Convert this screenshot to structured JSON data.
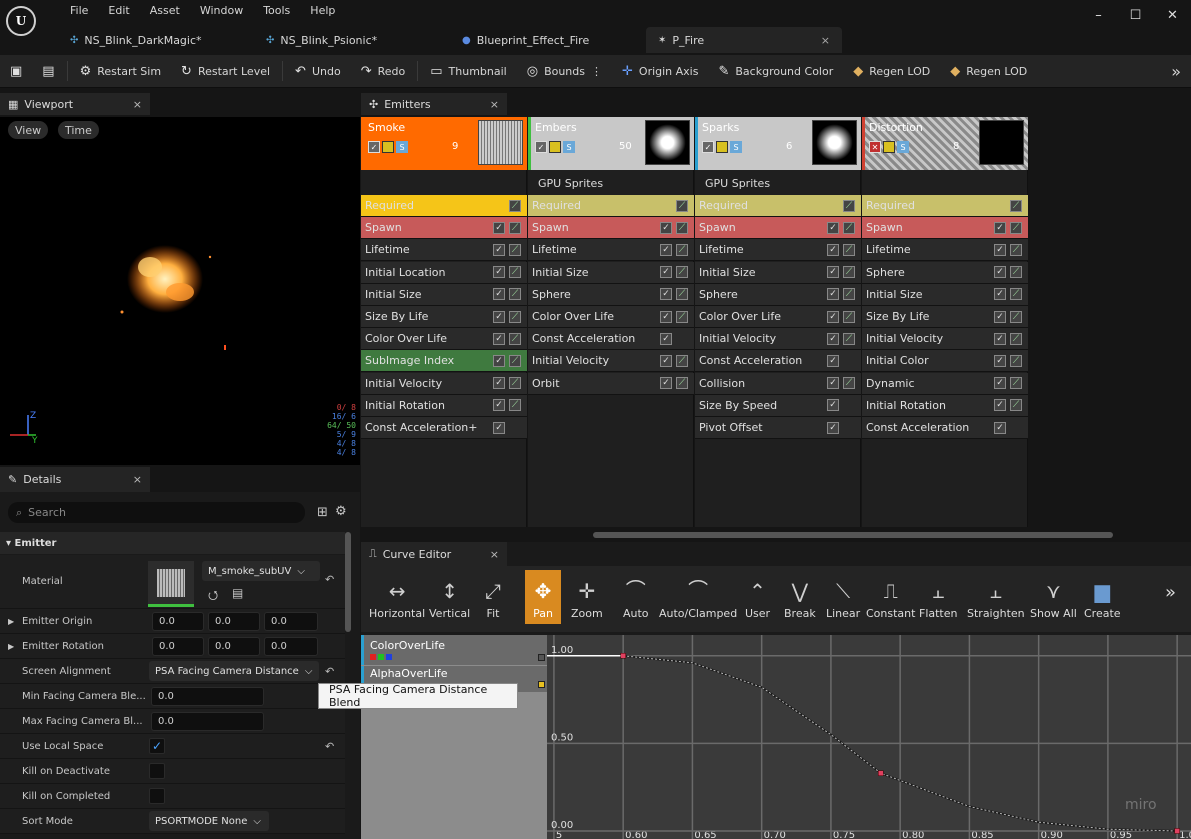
{
  "menu": [
    "File",
    "Edit",
    "Asset",
    "Window",
    "Tools",
    "Help"
  ],
  "logo": "U",
  "window_controls": [
    "–",
    "☐",
    "✕"
  ],
  "doc_tabs": [
    {
      "label": "NS_Blink_DarkMagic*",
      "active": false
    },
    {
      "label": "NS_Blink_Psionic*",
      "active": false
    },
    {
      "label": "Blueprint_Effect_Fire",
      "active": false
    },
    {
      "label": "P_Fire",
      "active": true,
      "close": "×"
    }
  ],
  "toolbar": {
    "restart_sim": "Restart Sim",
    "restart_level": "Restart Level",
    "undo": "Undo",
    "redo": "Redo",
    "thumbnail": "Thumbnail",
    "bounds": "Bounds",
    "origin_axis": "Origin Axis",
    "background_color": "Background Color",
    "regen_lod_1": "Regen LOD",
    "regen_lod_2": "Regen LOD",
    "more": "»"
  },
  "viewport": {
    "tab": "Viewport",
    "close": "×",
    "view_btn": "View",
    "time_btn": "Time",
    "axis_z": "Z",
    "axis_y": "Y",
    "stats": [
      {
        "text": "0/ 8",
        "color": "#d04040"
      },
      {
        "text": "16/ 6",
        "color": "#4a80e0"
      },
      {
        "text": "64/ 50",
        "color": "#5ac05a"
      },
      {
        "text": "5/ 9",
        "color": "#4a80e0"
      },
      {
        "text": "4/ 8",
        "color": "#4a80e0"
      },
      {
        "text": "4/ 8",
        "color": "#4a80e0"
      }
    ]
  },
  "emitters_panel": {
    "tab": "Emitters",
    "close": "×",
    "columns": [
      {
        "name": "Smoke",
        "count": "9",
        "head_color": "#ff6a00",
        "type": "",
        "stripe": "#ff6a00",
        "modules": [
          {
            "label": "Required",
            "bg": "#f5c518",
            "fg": "#ffffff",
            "c1": false
          },
          {
            "label": "Spawn",
            "bg": "#c75a5a",
            "fg": "#ffffff",
            "c1": true
          },
          {
            "label": "Lifetime",
            "bg": "#2a2a2a",
            "c1": true
          },
          {
            "label": "Initial Location",
            "bg": "#2a2a2a",
            "c1": true
          },
          {
            "label": "Initial Size",
            "bg": "#2a2a2a",
            "c1": true
          },
          {
            "label": "Size By Life",
            "bg": "#2a2a2a",
            "c1": true
          },
          {
            "label": "Color Over Life",
            "bg": "#2a2a2a",
            "c1": true
          },
          {
            "label": "SubImage Index",
            "bg": "#3f7a3f",
            "c1": true
          },
          {
            "label": "Initial Velocity",
            "bg": "#2a2a2a",
            "c1": true
          },
          {
            "label": "Initial Rotation",
            "bg": "#2a2a2a",
            "c1": true
          },
          {
            "label": "Const Acceleration+",
            "bg": "#2a2a2a",
            "c1": true,
            "no_c2": true
          }
        ]
      },
      {
        "name": "Embers",
        "count": "50",
        "head_color": "#c8c8c8",
        "type": "GPU Sprites",
        "stripe": "#3fbf3f",
        "modules": [
          {
            "label": "Required",
            "bg": "#c8c06a",
            "c1": false
          },
          {
            "label": "Spawn",
            "bg": "#c75a5a",
            "c1": true
          },
          {
            "label": "Lifetime",
            "bg": "#2a2a2a",
            "c1": true
          },
          {
            "label": "Initial Size",
            "bg": "#2a2a2a",
            "c1": true
          },
          {
            "label": "Sphere",
            "bg": "#2a2a2a",
            "c1": true
          },
          {
            "label": "Color Over Life",
            "bg": "#2a2a2a",
            "c1": true
          },
          {
            "label": "Const Acceleration",
            "bg": "#2a2a2a",
            "c1": true,
            "no_c2": true
          },
          {
            "label": "Initial Velocity",
            "bg": "#2a2a2a",
            "c1": true
          },
          {
            "label": "Orbit",
            "bg": "#2a2a2a",
            "c1": true
          }
        ]
      },
      {
        "name": "Sparks",
        "count": "6",
        "head_color": "#c8c8c8",
        "type": "GPU Sprites",
        "stripe": "#2aa0d0",
        "modules": [
          {
            "label": "Required",
            "bg": "#c8c06a",
            "c1": false
          },
          {
            "label": "Spawn",
            "bg": "#c75a5a",
            "c1": true
          },
          {
            "label": "Lifetime",
            "bg": "#2a2a2a",
            "c1": true
          },
          {
            "label": "Initial Size",
            "bg": "#2a2a2a",
            "c1": true
          },
          {
            "label": "Sphere",
            "bg": "#2a2a2a",
            "c1": true
          },
          {
            "label": "Color Over Life",
            "bg": "#2a2a2a",
            "c1": true
          },
          {
            "label": "Initial Velocity",
            "bg": "#2a2a2a",
            "c1": true
          },
          {
            "label": "Const Acceleration",
            "bg": "#2a2a2a",
            "c1": true,
            "no_c2": true
          },
          {
            "label": "Collision",
            "bg": "#2a2a2a",
            "c1": true
          },
          {
            "label": "Size By Speed",
            "bg": "#2a2a2a",
            "c1": true,
            "no_c2": true
          },
          {
            "label": "Pivot Offset",
            "bg": "#2a2a2a",
            "c1": true,
            "no_c2": true
          }
        ]
      },
      {
        "name": "Distortion",
        "count": "8",
        "head_color": "#9a9a9a",
        "type": "",
        "stripe": "#d04030",
        "modules": [
          {
            "label": "Required",
            "bg": "#c8c06a",
            "c1": false
          },
          {
            "label": "Spawn",
            "bg": "#c75a5a",
            "c1": true
          },
          {
            "label": "Lifetime",
            "bg": "#2a2a2a",
            "c1": true
          },
          {
            "label": "Sphere",
            "bg": "#2a2a2a",
            "c1": true
          },
          {
            "label": "Initial Size",
            "bg": "#2a2a2a",
            "c1": true
          },
          {
            "label": "Size By Life",
            "bg": "#2a2a2a",
            "c1": true
          },
          {
            "label": "Initial Velocity",
            "bg": "#2a2a2a",
            "c1": true
          },
          {
            "label": "Initial Color",
            "bg": "#2a2a2a",
            "c1": true
          },
          {
            "label": "Dynamic",
            "bg": "#2a2a2a",
            "c1": true
          },
          {
            "label": "Initial Rotation",
            "bg": "#2a2a2a",
            "c1": true
          },
          {
            "label": "Const Acceleration",
            "bg": "#2a2a2a",
            "c1": true,
            "no_c2": true
          }
        ]
      }
    ]
  },
  "details": {
    "tab": "Details",
    "close": "×",
    "search_placeholder": "Search",
    "section": "Emitter",
    "material_label": "Material",
    "material_value": "M_smoke_subUV",
    "emitter_origin": {
      "label": "Emitter Origin",
      "values": [
        "0.0",
        "0.0",
        "0.0"
      ]
    },
    "emitter_rotation": {
      "label": "Emitter Rotation",
      "values": [
        "0.0",
        "0.0",
        "0.0"
      ]
    },
    "screen_alignment": {
      "label": "Screen Alignment",
      "value": "PSA Facing Camera Distance"
    },
    "min_facing": {
      "label": "Min Facing Camera Ble...",
      "value": "0.0"
    },
    "max_facing": {
      "label": "Max Facing Camera Bl...",
      "value": "0.0"
    },
    "use_local_space": {
      "label": "Use Local Space",
      "checked": true
    },
    "kill_on_deactivate": {
      "label": "Kill on Deactivate"
    },
    "kill_on_completed": {
      "label": "Kill on Completed"
    },
    "sort_mode": {
      "label": "Sort Mode",
      "value": "PSORTMODE None"
    }
  },
  "tooltip": "PSA Facing Camera Distance Blend",
  "curve_editor": {
    "tab": "Curve Editor",
    "close": "×",
    "tools": [
      "Horizontal",
      "Vertical",
      "Fit",
      "Pan",
      "Zoom",
      "Auto",
      "Auto/Clamped",
      "User",
      "Break",
      "Linear",
      "Constant",
      "Flatten",
      "Straighten",
      "Show All",
      "Create"
    ],
    "more": "»",
    "tracks": [
      {
        "label": "ColorOverLife"
      },
      {
        "label": "AlphaOverLife"
      }
    ],
    "y_labels": [
      "1.00",
      "0.50",
      "0.00"
    ],
    "x_labels": [
      "0.55",
      "0.60",
      "0.65",
      "0.70",
      "0.75",
      "0.80",
      "0.85",
      "0.90",
      "0.95",
      "1.00"
    ],
    "x_first_label": "5",
    "watermark": "miro"
  },
  "chart_data": {
    "type": "line",
    "title": "",
    "xlabel": "",
    "ylabel": "",
    "xlim": [
      0.545,
      1.01
    ],
    "ylim": [
      0.0,
      1.05
    ],
    "series": [
      {
        "x": [
          0.6,
          0.65,
          0.7,
          0.75,
          0.786,
          0.85,
          0.9,
          0.95,
          1.0
        ],
        "y": [
          1.0,
          0.96,
          0.82,
          0.55,
          0.33,
          0.14,
          0.05,
          0.01,
          0.0
        ]
      }
    ],
    "keys": [
      {
        "x": 0.6,
        "y": 1.0
      },
      {
        "x": 0.786,
        "y": 0.33
      },
      {
        "x": 1.0,
        "y": 0.0
      }
    ]
  }
}
